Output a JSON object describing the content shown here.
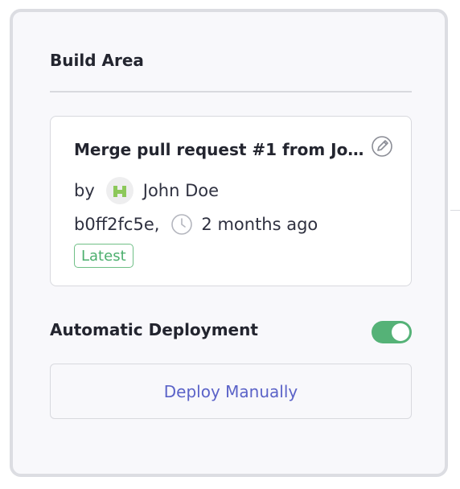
{
  "panel": {
    "title": "Build Area"
  },
  "commit": {
    "title": "Merge pull request #1 from John...",
    "by_label": "by",
    "author": "John Doe",
    "hash": "b0ff2fc5e,",
    "time": "2 months ago",
    "badge": "Latest"
  },
  "auto_deploy": {
    "label": "Automatic Deployment",
    "enabled": true
  },
  "deploy_button": {
    "label": "Deploy Manually"
  },
  "colors": {
    "accent": "#5b63c8",
    "toggle_on": "#55b277",
    "badge": "#4caf6e"
  },
  "icons": [
    "edit-icon",
    "clock-icon",
    "avatar"
  ]
}
